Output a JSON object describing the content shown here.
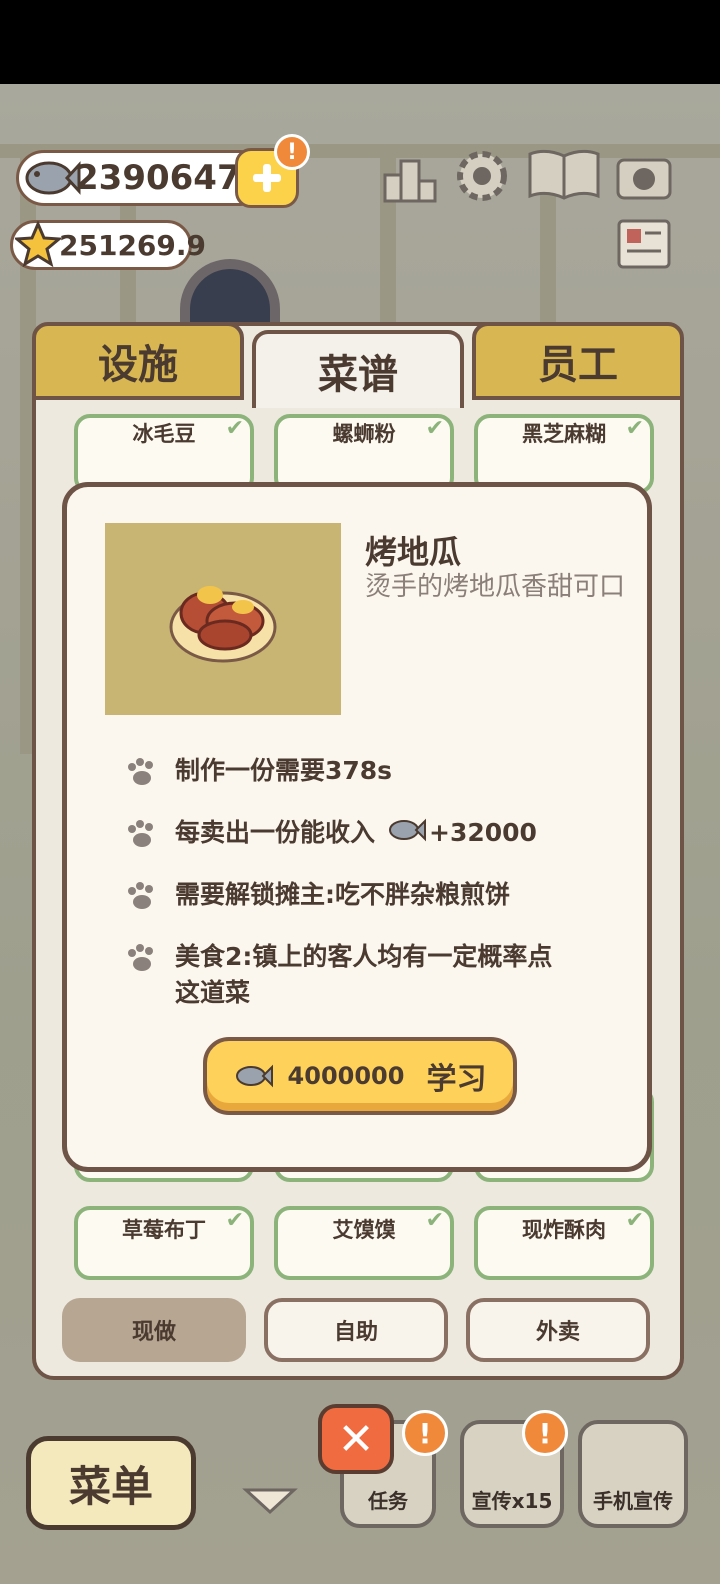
{
  "currency": {
    "fish": "23906476",
    "stars": "251269.9"
  },
  "tabs": [
    {
      "label": "设施",
      "active": false
    },
    {
      "label": "菜谱",
      "active": true
    },
    {
      "label": "员工",
      "active": false
    }
  ],
  "recipes_top": [
    "冰毛豆",
    "螺蛳粉",
    "黑芝麻糊"
  ],
  "recipes_bottom": [
    "草莓布丁",
    "艾馍馍",
    "现炸酥肉"
  ],
  "dish": {
    "name": "烤地瓜",
    "description": "烫手的烤地瓜香甜可口",
    "info": {
      "time": "制作一份需要378s",
      "income_prefix": "每卖出一份能收入",
      "income_value": "+32000",
      "unlock": "需要解锁摊主:吃不胖杂粮煎饼",
      "effect": "美食2:镇上的客人均有一定概率点这道菜"
    },
    "learn": {
      "price": "4000000",
      "label": "学习"
    }
  },
  "modes": [
    {
      "label": "现做",
      "active": true
    },
    {
      "label": "自助",
      "active": false
    },
    {
      "label": "外卖",
      "active": false
    }
  ],
  "hud": {
    "menu": "菜单",
    "tasks": "任务",
    "promo": "宣传x15",
    "phone_promo": "手机宣传",
    "alert": "!"
  },
  "colors": {
    "accent": "#fdd15a",
    "tab_inactive": "#d8b752",
    "card_border": "#8bb37a",
    "badge": "#f08a3a"
  },
  "icons": [
    "fish-icon",
    "star-icon",
    "plus-icon",
    "ranking-icon",
    "gear-icon",
    "recipe-book-icon",
    "camera-icon",
    "newspaper-icon",
    "paw-icon",
    "close-icon",
    "chevron-down-icon"
  ]
}
